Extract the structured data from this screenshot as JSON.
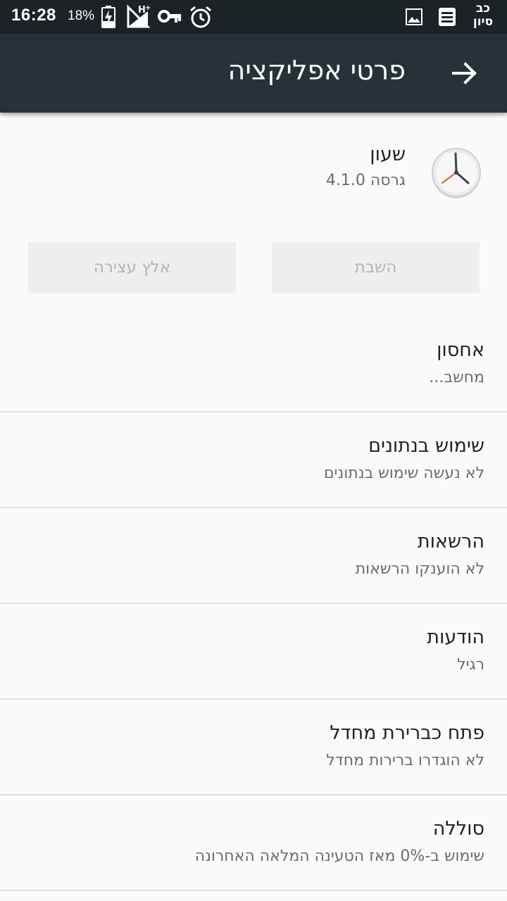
{
  "status_bar": {
    "time": "16:28",
    "battery_percent": "18%",
    "carrier": [
      "כב",
      "סיון"
    ],
    "network_badge": "H+"
  },
  "toolbar": {
    "title": "פרטי אפליקציה"
  },
  "app": {
    "name": "שעון",
    "version": "גרסה 4.1.0"
  },
  "buttons": {
    "disable": "השבת",
    "force_stop": "אלץ עצירה"
  },
  "settings": [
    {
      "title": "אחסון",
      "subtitle": "מחשב..."
    },
    {
      "title": "שימוש בנתונים",
      "subtitle": "לא נעשה שימוש בנתונים"
    },
    {
      "title": "הרשאות",
      "subtitle": "לא הוענקו הרשאות"
    },
    {
      "title": "הודעות",
      "subtitle": "רגיל"
    },
    {
      "title": "פתח כברירת מחדל",
      "subtitle": "לא הוגדרו ברירות מחדל"
    },
    {
      "title": "סוללה",
      "subtitle": "שימוש ב-0% מאז הטעינה המלאה האחרונה"
    }
  ],
  "colors": {
    "status_bar": "#1b2326",
    "toolbar": "#263238",
    "background": "#fafafa",
    "button_bg": "#eeeeee",
    "button_text_disabled": "#b4b4b4"
  },
  "icons": {
    "status_left": [
      "battery-charging-icon",
      "signal-h-plus-icon",
      "vpn-key-icon",
      "alarm-icon"
    ],
    "status_right": [
      "image-icon",
      "notes-icon"
    ],
    "back": "arrow-right-icon",
    "app": "clock-icon"
  }
}
